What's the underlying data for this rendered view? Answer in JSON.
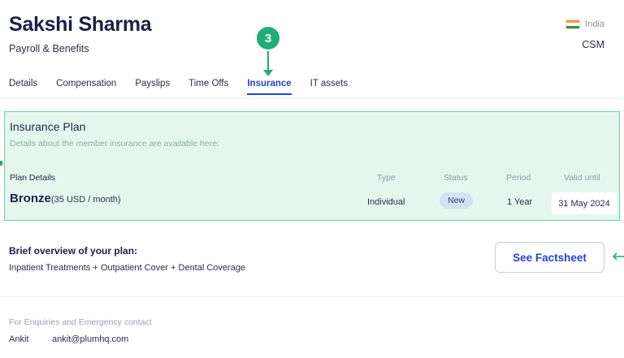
{
  "profile": {
    "name": "Sakshi Sharma",
    "role": "Payroll & Benefits",
    "country": "India",
    "team": "CSM"
  },
  "tabs": [
    {
      "label": "Details"
    },
    {
      "label": "Compensation"
    },
    {
      "label": "Payslips"
    },
    {
      "label": "Time Offs"
    },
    {
      "label": "Insurance",
      "active": true
    },
    {
      "label": "IT assets"
    }
  ],
  "step": {
    "number": "3"
  },
  "insurance": {
    "title": "Insurance Plan",
    "subtitle": "Details about the member insurance are available here:",
    "columns": {
      "plan": "Plan Details",
      "type": "Type",
      "status": "Status",
      "period": "Period",
      "valid": "Valid until"
    },
    "plan": {
      "name": "Bronze",
      "price": "(35 USD / month)",
      "type": "Individual",
      "status": "New",
      "period": "1 Year",
      "valid_until": "31 May 2024"
    }
  },
  "overview": {
    "title": "Brief overview of your plan:",
    "text": "Inpatient Treatments + Outpatient Cover + Dental Coverage",
    "factsheet_label": "See Factsheet"
  },
  "enquiry": {
    "label": "For Enquiries and Emergency contact",
    "name": "Ankit",
    "email": "ankit@plumhq.com"
  },
  "colors": {
    "accent": "#2742d6",
    "highlight": "#1fae76",
    "card_bg": "#e5f6ee"
  },
  "icons": {
    "flag": "india-flag-icon",
    "arrow_down": "arrow-down-icon",
    "arrow_left": "arrow-left-icon"
  }
}
